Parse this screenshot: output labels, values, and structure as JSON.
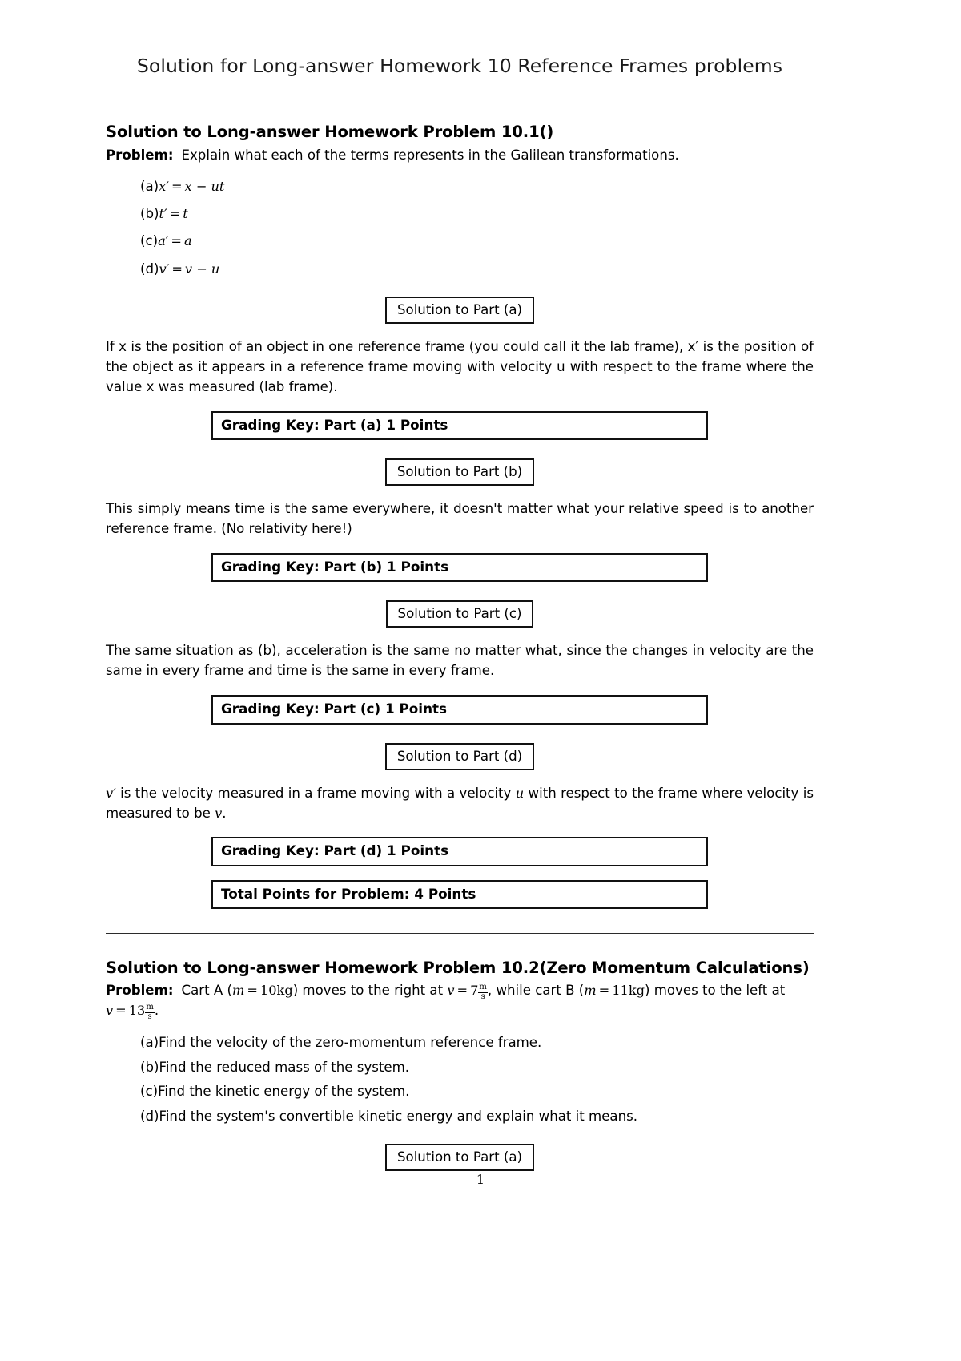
{
  "document": {
    "title": "Solution for Long-answer Homework 10 Reference Frames problems",
    "page_number": "1"
  },
  "problem1": {
    "heading": "Solution to Long-answer Homework Problem 10.1()",
    "problem_label": "Problem:",
    "problem_text": "Explain what each of the terms represents in the Galilean transformations.",
    "items": [
      {
        "label": "(a)",
        "eq_lhs": "x′",
        "eq_rel": "=",
        "eq_rhs": "x − ut"
      },
      {
        "label": "(b)",
        "eq_lhs": "t′",
        "eq_rel": "=",
        "eq_rhs": "t"
      },
      {
        "label": "(c)",
        "eq_lhs": "a′",
        "eq_rel": "=",
        "eq_rhs": "a"
      },
      {
        "label": "(d)",
        "eq_lhs": "v′",
        "eq_rel": "=",
        "eq_rhs": "v − u"
      }
    ],
    "parts": [
      {
        "box_label": "Solution to Part (a)",
        "solution_text": "If x is the position of an object in one reference frame (you could call it the lab frame), x′ is the position of the object as it appears in a reference frame moving with velocity u with respect to the frame where the value x was measured (lab frame).",
        "grading_key": "Grading Key: Part (a) 1 Points"
      },
      {
        "box_label": "Solution to Part (b)",
        "solution_text": "This simply means time is the same everywhere, it doesn't matter what your relative speed is to another reference frame. (No relativity here!)",
        "grading_key": "Grading Key: Part (b) 1 Points"
      },
      {
        "box_label": "Solution to Part (c)",
        "solution_text": "The same situation as (b), acceleration is the same no matter what, since the changes in velocity are the same in every frame and time is the same in every frame.",
        "grading_key": "Grading Key: Part (c) 1 Points"
      },
      {
        "box_label": "Solution to Part (d)",
        "solution_text": "v′ is the velocity measured in a frame moving with a velocity u with respect to the frame where velocity is measured to be v.",
        "grading_key": "Grading Key: Part (d) 1 Points"
      }
    ],
    "total_points": "Total Points for Problem: 4 Points"
  },
  "problem2": {
    "heading": "Solution to Long-answer Homework Problem 10.2(Zero Momentum Calculations)",
    "problem_label": "Problem:",
    "problem_text": "Cart A (m = 10kg) moves to the right at v = 7 m/s, while cart B (m = 11kg) moves to the left at v = 13 m/s.",
    "values": {
      "cart_a_mass": "10",
      "cart_a_mass_unit": "kg",
      "cart_a_velocity": "7",
      "cart_b_mass": "11",
      "cart_b_mass_unit": "kg",
      "cart_b_velocity": "13",
      "velocity_unit_num": "m",
      "velocity_unit_den": "s"
    },
    "items": [
      {
        "label": "(a)",
        "text": "Find the velocity of the zero-momentum reference frame."
      },
      {
        "label": "(b)",
        "text": "Find the reduced mass of the system."
      },
      {
        "label": "(c)",
        "text": "Find the kinetic energy of the system."
      },
      {
        "label": "(d)",
        "text": "Find the system's convertible kinetic energy and explain what it means."
      }
    ],
    "parts": [
      {
        "box_label": "Solution to Part (a)"
      }
    ]
  }
}
